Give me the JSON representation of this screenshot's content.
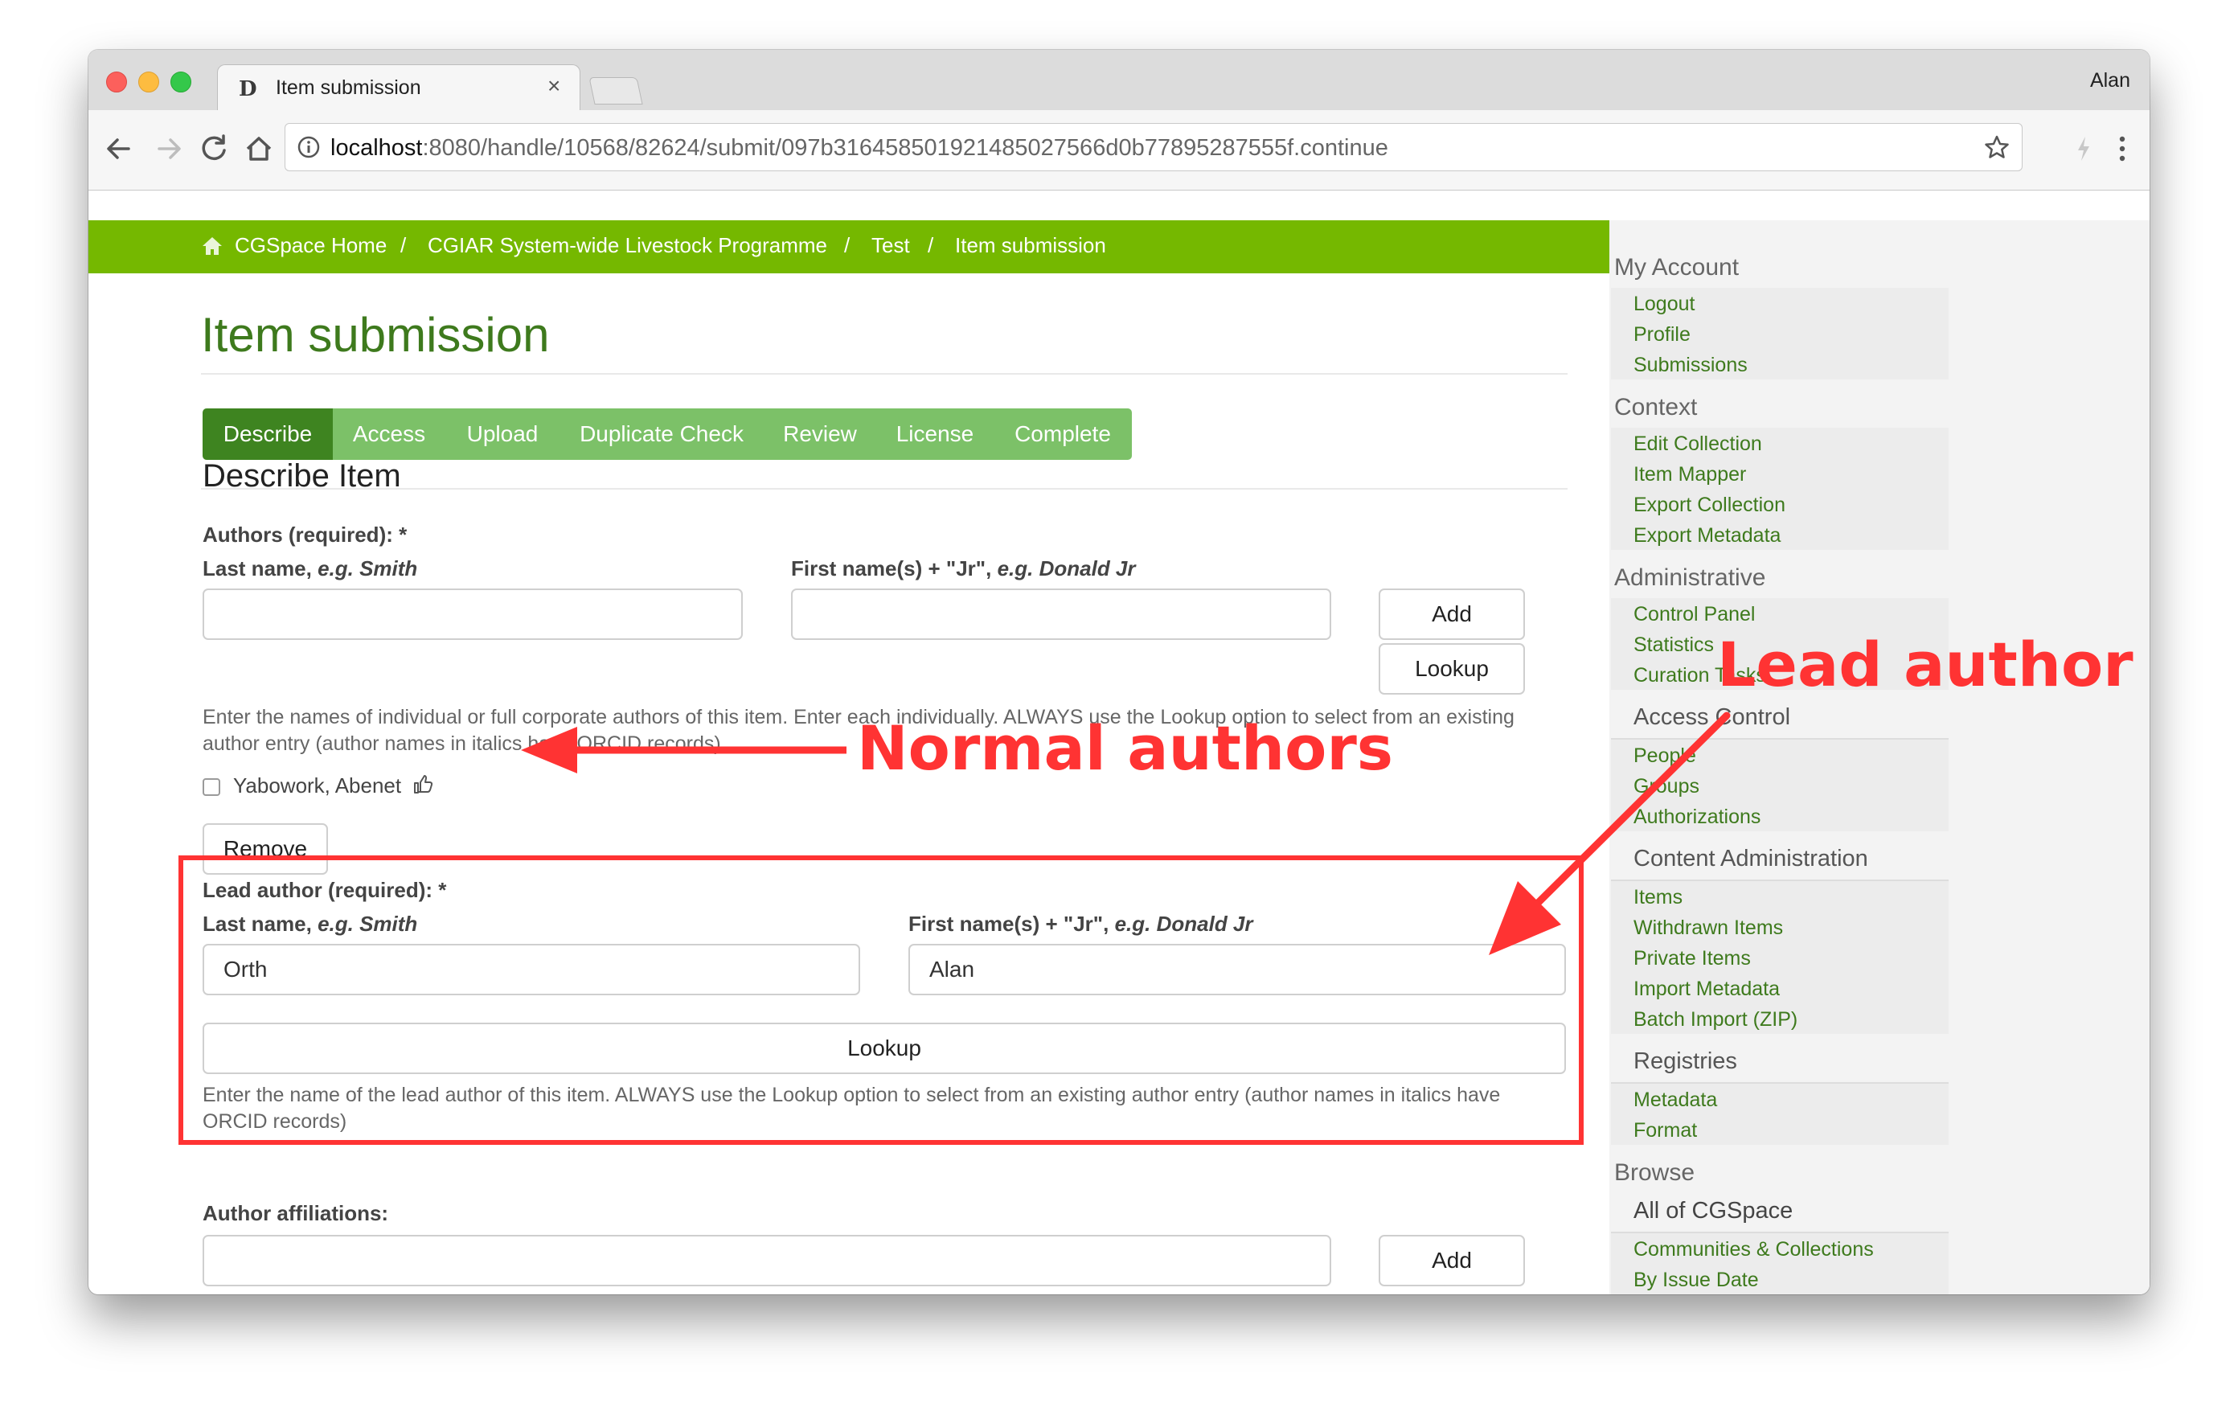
{
  "browser": {
    "tab_title": "Item submission",
    "tab_close": "×",
    "profile_name": "Alan",
    "url_host": "localhost",
    "url_rest": ":8080/handle/10568/82624/submit/097b3164585019214850275 66d0b77895287555f.continue",
    "url_full_rest": ":8080/handle/10568/82624/submit/097b316458501921485027566d0b77895287555f.continue"
  },
  "breadcrumb": {
    "items": [
      "CGSpace Home",
      "CGIAR System-wide Livestock Programme",
      "Test",
      "Item submission"
    ],
    "separator": "/"
  },
  "page": {
    "title": "Item submission",
    "section_title": "Describe Item"
  },
  "steps": [
    "Describe",
    "Access",
    "Upload",
    "Duplicate Check",
    "Review",
    "License",
    "Complete"
  ],
  "authors": {
    "label": "Authors (required): *",
    "last_name_label": "Last name, ",
    "last_name_example": "e.g. Smith",
    "first_name_label": "First name(s) + \"Jr\", ",
    "first_name_example": "e.g. Donald Jr",
    "add_button": "Add",
    "lookup_button": "Lookup",
    "help": "Enter the names of individual or full corporate authors of this item. Enter each individually. ALWAYS use the Lookup option to select from an existing author entry (author names in italics have ORCID records)",
    "entries": [
      "Yabowork, Abenet"
    ],
    "remove_button": "Remove"
  },
  "lead_author": {
    "label": "Lead author (required): *",
    "last_name_label": "Last name, ",
    "last_name_example": "e.g. Smith",
    "first_name_label": "First name(s) + \"Jr\", ",
    "first_name_example": "e.g. Donald Jr",
    "last_name_value": "Orth",
    "first_name_value": "Alan",
    "lookup_button": "Lookup",
    "help": "Enter the name of the lead author of this item. ALWAYS use the Lookup option to select from an existing author entry (author names in italics have ORCID records)"
  },
  "affiliations": {
    "label": "Author affiliations:",
    "add_button": "Add"
  },
  "sidebar": {
    "my_account": {
      "heading": "My Account",
      "links": [
        "Logout",
        "Profile",
        "Submissions"
      ]
    },
    "context": {
      "heading": "Context",
      "links": [
        "Edit Collection",
        "Item Mapper",
        "Export Collection",
        "Export Metadata"
      ]
    },
    "administrative": {
      "heading": "Administrative",
      "links": [
        "Control Panel",
        "Statistics",
        "Curation Tasks"
      ]
    },
    "access_control": {
      "heading": "Access Control",
      "links": [
        "People",
        "Groups",
        "Authorizations"
      ]
    },
    "content_admin": {
      "heading": "Content Administration",
      "links": [
        "Items",
        "Withdrawn Items",
        "Private Items",
        "Import Metadata",
        "Batch Import (ZIP)"
      ]
    },
    "registries": {
      "heading": "Registries",
      "links": [
        "Metadata",
        "Format"
      ]
    },
    "browse": {
      "heading": "Browse",
      "subheading": "All of CGSpace",
      "links": [
        "Communities & Collections",
        "By Issue Date"
      ]
    }
  },
  "annotations": {
    "normal_authors": "Normal authors",
    "lead_author": "Lead author",
    "color": "#ff3333"
  },
  "colors": {
    "brand_green": "#75b800",
    "title_green": "#3e7a1d",
    "step_active": "#3e8420",
    "step_inactive": "#7cc168"
  }
}
